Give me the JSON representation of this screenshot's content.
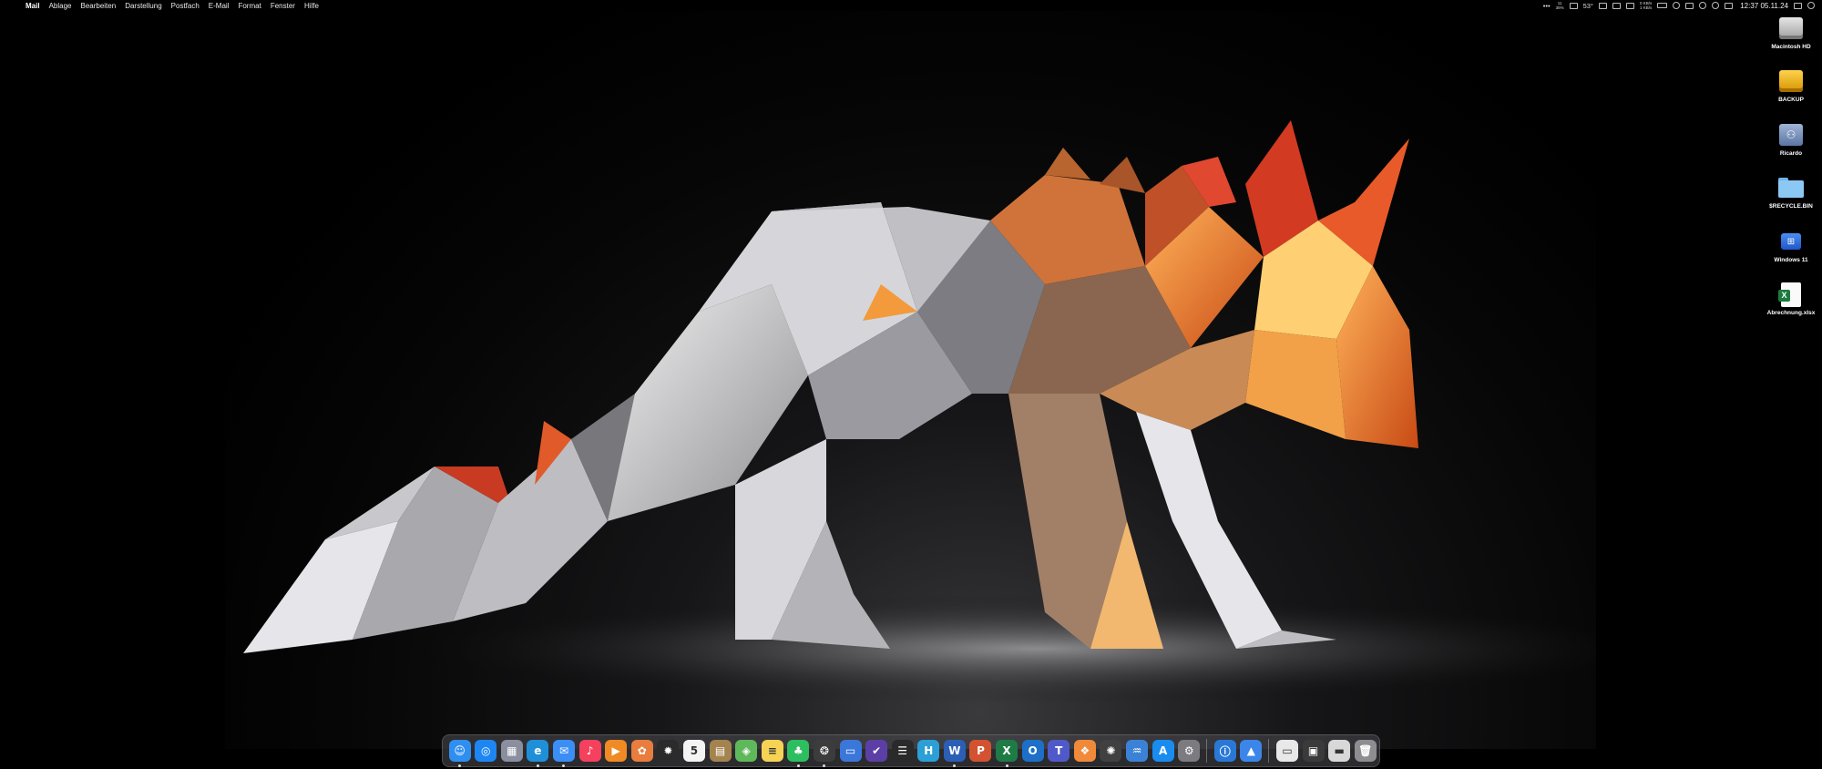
{
  "menubar": {
    "app_name": "Mail",
    "menus": [
      "Ablage",
      "Bearbeiten",
      "Darstellung",
      "Postfach",
      "E-Mail",
      "Format",
      "Fenster",
      "Hilfe"
    ],
    "status": {
      "more": "•••",
      "cpu_top": "11",
      "cpu_bottom": "36%",
      "temperature": "53°",
      "net_up": "0 KB/s",
      "net_down": "1 KB/s",
      "clock": "12:37 05.11.24"
    }
  },
  "desktop_icons": [
    {
      "label": "Macintosh HD",
      "icon": "internal-drive-icon"
    },
    {
      "label": "BACKUP",
      "icon": "external-drive-icon"
    },
    {
      "label": "Ricardo",
      "icon": "network-share-icon"
    },
    {
      "label": "$RECYCLE.BIN",
      "icon": "folder-icon"
    },
    {
      "label": "Windows 11",
      "icon": "windows-vm-icon"
    },
    {
      "label": "Abrechnung.xlsx",
      "icon": "excel-file-icon"
    }
  ],
  "dock": {
    "apps": [
      {
        "name": "finder",
        "glyph": "☺",
        "color": "#2f8ff0",
        "running": true
      },
      {
        "name": "safari",
        "glyph": "◎",
        "color": "#1e86f2",
        "running": false
      },
      {
        "name": "launchpad",
        "glyph": "▦",
        "color": "#8a8fa0",
        "running": false
      },
      {
        "name": "edge",
        "glyph": "e",
        "color": "#1f8fd8",
        "running": true
      },
      {
        "name": "mail",
        "glyph": "✉",
        "color": "#3a8ef5",
        "running": true
      },
      {
        "name": "music",
        "glyph": "♪",
        "color": "#f5405e",
        "running": false
      },
      {
        "name": "infuse",
        "glyph": "▶",
        "color": "#f08a24",
        "running": false
      },
      {
        "name": "photos",
        "glyph": "✿",
        "color": "#e87d3e",
        "running": false
      },
      {
        "name": "sunburst",
        "glyph": "✹",
        "color": "#2b2b2b",
        "running": false
      },
      {
        "name": "calendar",
        "glyph": "5",
        "color": "#f4f4f4",
        "running": false
      },
      {
        "name": "notes-brown",
        "glyph": "▤",
        "color": "#a3844e",
        "running": false
      },
      {
        "name": "maps",
        "glyph": "◈",
        "color": "#5fb85a",
        "running": false
      },
      {
        "name": "notes",
        "glyph": "≡",
        "color": "#f6d355",
        "running": false
      },
      {
        "name": "evernote",
        "glyph": "♣",
        "color": "#2dbe60",
        "running": true
      },
      {
        "name": "chatgpt",
        "glyph": "❂",
        "color": "#3c3c3c",
        "running": true
      },
      {
        "name": "screens",
        "glyph": "▭",
        "color": "#3b76d9",
        "running": false
      },
      {
        "name": "omnifocus",
        "glyph": "✔",
        "color": "#5b3fa6",
        "running": false
      },
      {
        "name": "taskheat",
        "glyph": "☰",
        "color": "#2a2a2a",
        "running": false
      },
      {
        "name": "hook",
        "glyph": "H",
        "color": "#2c9fd6",
        "running": false
      },
      {
        "name": "word",
        "glyph": "W",
        "color": "#2b5fb5",
        "running": true
      },
      {
        "name": "powerpoint",
        "glyph": "P",
        "color": "#d35230",
        "running": false
      },
      {
        "name": "excel",
        "glyph": "X",
        "color": "#1e7b45",
        "running": true
      },
      {
        "name": "outlook",
        "glyph": "O",
        "color": "#1d6fc7",
        "running": false
      },
      {
        "name": "teams",
        "glyph": "T",
        "color": "#5059c9",
        "running": false
      },
      {
        "name": "shortcuts",
        "glyph": "❖",
        "color": "#f08a3a",
        "running": false
      },
      {
        "name": "openai",
        "glyph": "✺",
        "color": "#404040",
        "running": false
      },
      {
        "name": "activity",
        "glyph": "♒",
        "color": "#3b82d6",
        "running": false
      },
      {
        "name": "appstore",
        "glyph": "A",
        "color": "#1a8cf0",
        "running": false
      },
      {
        "name": "settings",
        "glyph": "⚙",
        "color": "#7b7b80",
        "running": false
      }
    ],
    "apps_right": [
      {
        "name": "onepassword",
        "glyph": "ⓘ",
        "color": "#2a78d6",
        "running": false
      },
      {
        "name": "deskapp",
        "glyph": "▲",
        "color": "#3b86e8",
        "running": false
      }
    ],
    "docs": [
      {
        "name": "downloads-stack",
        "glyph": "▭",
        "color": "#e8e8e8"
      },
      {
        "name": "screenshot-stack",
        "glyph": "▣",
        "color": "#3a3a3a"
      },
      {
        "name": "documents-stack",
        "glyph": "▬",
        "color": "#d8d8d8"
      },
      {
        "name": "trash",
        "glyph": "🗑",
        "color": "#8e8e92"
      }
    ]
  }
}
